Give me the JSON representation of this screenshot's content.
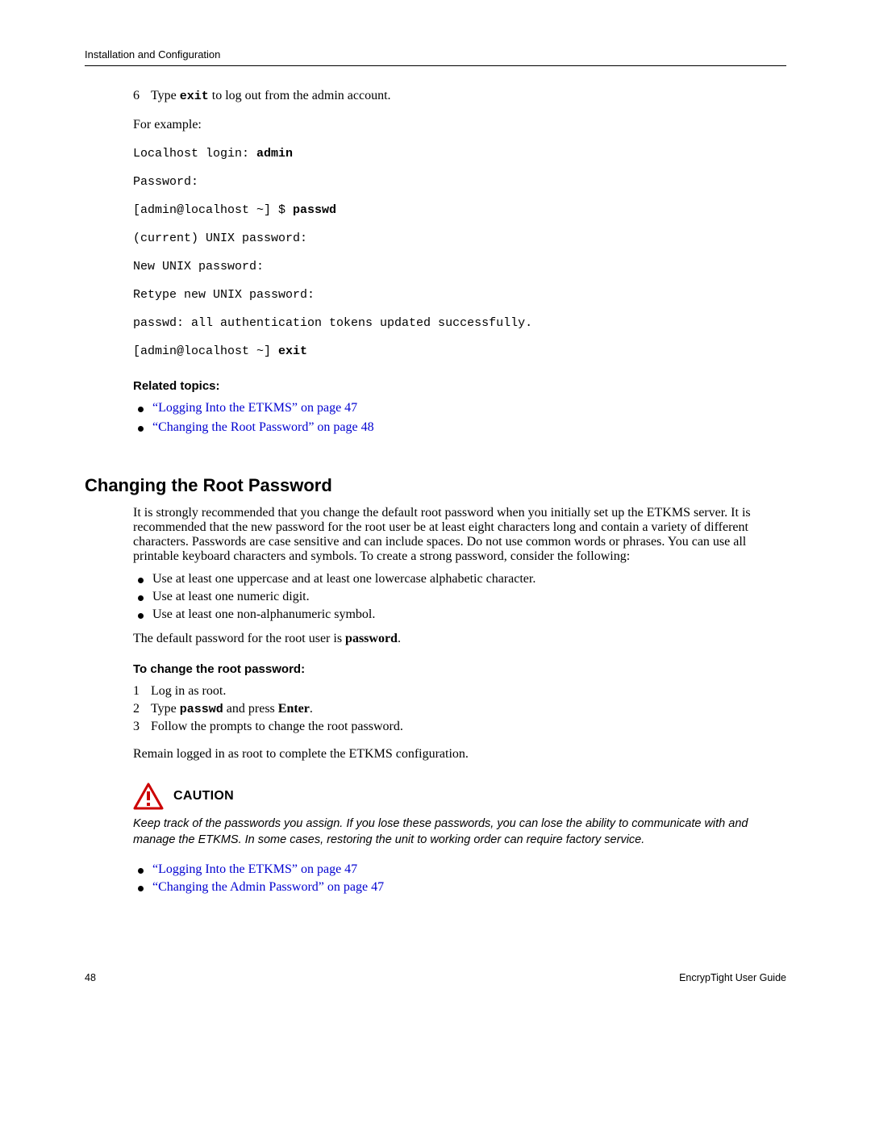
{
  "header": "Installation and Configuration",
  "step6": {
    "num": "6",
    "pre": "Type ",
    "cmd": "exit",
    "post": " to log out from the admin account."
  },
  "example_label": "For example:",
  "term": {
    "l1_pre": "Localhost login: ",
    "l1_bold": "admin",
    "l2": "Password:",
    "l3_pre": "[admin@localhost ~] $ ",
    "l3_bold": "passwd",
    "l4": "(current) UNIX password:",
    "l5": "New UNIX password:",
    "l6": "Retype new UNIX password:",
    "l7": "passwd: all authentication tokens updated successfully.",
    "l8_pre": "[admin@localhost ~] ",
    "l8_bold": "exit"
  },
  "related_topics_heading": "Related topics:",
  "related1": "“Logging Into the ETKMS” on page 47",
  "related2": "“Changing the Root Password” on page 48",
  "section_heading": "Changing the Root Password",
  "intro_para": "It is strongly recommended that you change the default root password when you initially set up the ETKMS server. It is recommended that the new password for the root user be at least eight characters long and contain a variety of different characters. Passwords are case sensitive and can include spaces. Do not use common words or phrases. You can use all printable keyboard characters and symbols. To create a strong password, consider the following:",
  "tip1": "Use at least one uppercase and at least one lowercase alphabetic character.",
  "tip2": "Use at least one numeric digit.",
  "tip3": "Use at least one non-alphanumeric symbol.",
  "default_pw_pre": "The default password for the root user is ",
  "default_pw_bold": "password",
  "default_pw_post": ".",
  "to_change_heading": "To change the root password:",
  "s1": {
    "n": "1",
    "t": "Log in as root."
  },
  "s2": {
    "n": "2",
    "pre": "Type ",
    "cmd": "passwd",
    "mid": " and press ",
    "btn": "Enter",
    "post": "."
  },
  "s3": {
    "n": "3",
    "t": "Follow the prompts to change the root password."
  },
  "remain_para": "Remain logged in as root to complete the ETKMS configuration.",
  "caution_label": "CAUTION",
  "caution_text": "Keep track of the passwords you assign. If you lose these passwords, you can lose the ability to communicate with and manage the ETKMS. In some cases, restoring the unit to working order can require factory service.",
  "related3": "“Logging Into the ETKMS” on page 47",
  "related4": "“Changing the Admin Password” on page 47",
  "footer_page": "48",
  "footer_doc": "EncrypTight User Guide"
}
